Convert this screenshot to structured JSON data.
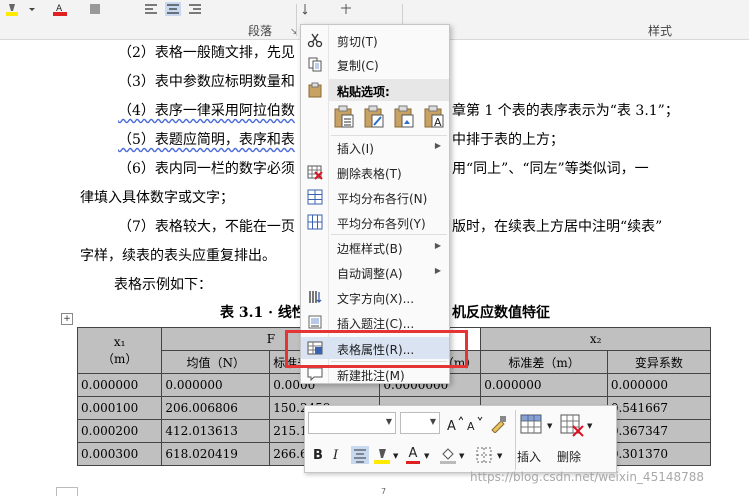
{
  "ribbon": {
    "paragraph_group": "段落",
    "styles_group": "样式"
  },
  "doc": {
    "lines": [
      "（2）表格一般随文排，先见",
      "（3）表中参数应标明数量和",
      "（4）表序一律采用阿拉伯数",
      "章第 1 个表的表序表示为“表 3.1”；",
      "（5）表题应简明，表序和表",
      "中排于表的上方；",
      "（6）表内同一栏的数字必须",
      "用“同上”、“同左”等类似词，一",
      "律填入具体数字或文字；",
      "（7）表格较大，不能在一页",
      "版时，在续表上方居中注明“续表”",
      "字样，续表的表头应重复排出。",
      "表格示例如下：",
      "表 3.1 · 线性",
      "机反应数值特征"
    ]
  },
  "table": {
    "header1": [
      "x₁",
      "F",
      "x₂"
    ],
    "header2": [
      "（m）",
      "均值（N）",
      "标准差",
      "值（m）",
      "标准差（m）",
      "变异系数"
    ],
    "rows": [
      [
        "0.000000",
        "0.000000",
        "0.0000",
        "0.0000000",
        "0.000000",
        "0.000000"
      ],
      [
        "0.000100",
        "206.006806",
        "150.2459",
        "",
        "",
        "0.541667"
      ],
      [
        "0.000200",
        "412.013613",
        "215.1000",
        "",
        "",
        "0.367347"
      ],
      [
        "0.000300",
        "618.020419",
        "266.6132",
        "",
        "",
        "0.301370"
      ]
    ]
  },
  "context_menu": {
    "items": [
      {
        "label": "剪切(T)",
        "icon": "scissors-icon"
      },
      {
        "label": "复制(C)",
        "icon": "copy-icon"
      },
      {
        "label": "插入(I)",
        "icon": "",
        "submenu": true
      },
      {
        "label": "删除表格(T)",
        "icon": "delete-table-icon"
      },
      {
        "label": "平均分布各行(N)",
        "icon": "distribute-rows-icon"
      },
      {
        "label": "平均分布各列(Y)",
        "icon": "distribute-columns-icon"
      },
      {
        "label": "边框样式(B)",
        "icon": "",
        "submenu": true
      },
      {
        "label": "自动调整(A)",
        "icon": "",
        "submenu": true
      },
      {
        "label": "文字方向(X)...",
        "icon": "text-direction-icon"
      },
      {
        "label": "插入题注(C)...",
        "icon": "insert-caption-icon"
      },
      {
        "label": "表格属性(R)...",
        "icon": "table-properties-icon"
      },
      {
        "label": "新建批注(M)",
        "icon": "new-comment-icon"
      }
    ],
    "paste_header": "粘贴选项:"
  },
  "mini_toolbar": {
    "insert_label": "插入",
    "delete_label": "删除",
    "bold": "B",
    "italic": "I",
    "font_color_letter": "A"
  },
  "footer": {
    "page_number": "7"
  },
  "watermark": "https://blog.csdn.net/weixin_45148788",
  "colors": {
    "selection": "#c0c0c0",
    "menu_highlight": "#d9e3f2",
    "red_box": "#e53434"
  }
}
